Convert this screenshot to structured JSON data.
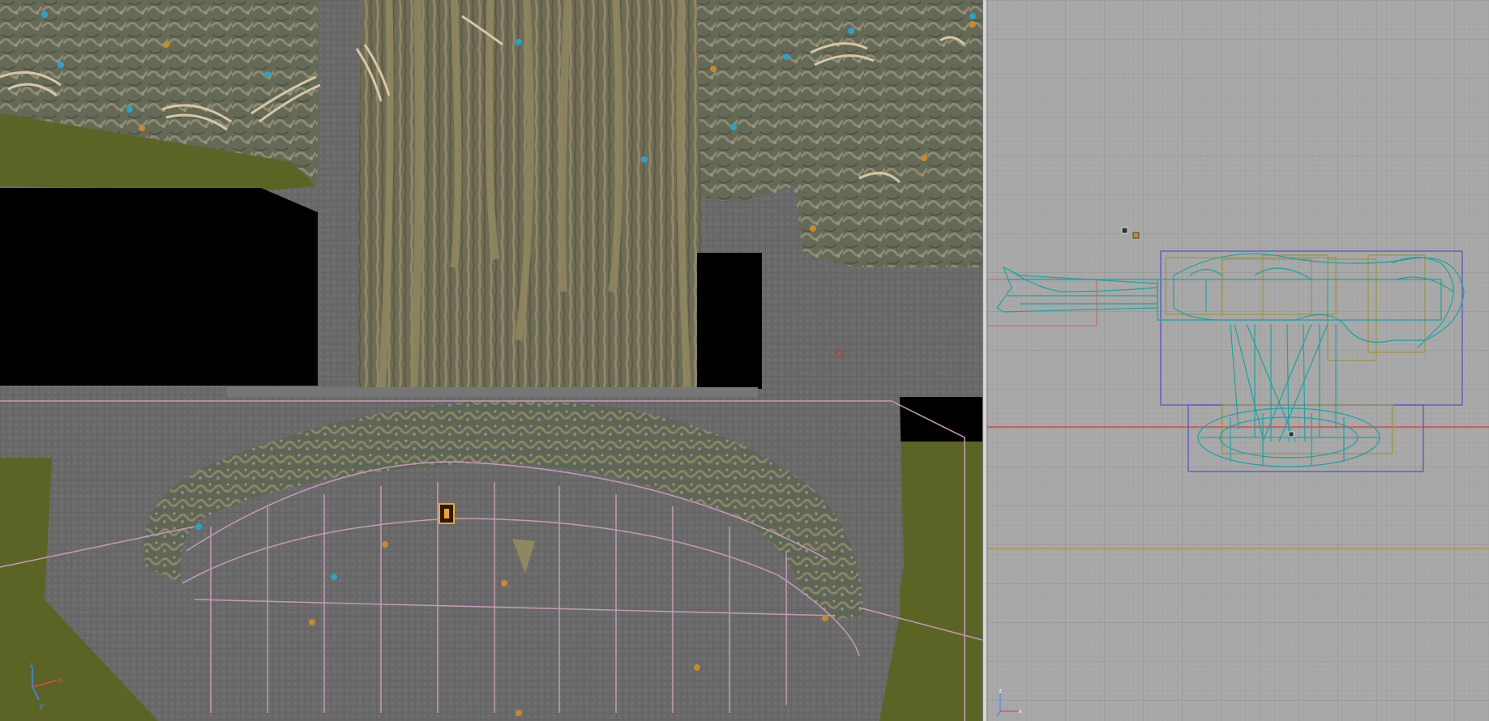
{
  "app": {
    "viewports": [
      {
        "id": "perspective",
        "axes": {
          "x": "x",
          "y": "y",
          "z": "z"
        }
      },
      {
        "id": "top",
        "axes": {
          "x": "x",
          "y": "y",
          "z": "z"
        }
      }
    ]
  },
  "colors": {
    "void": "#000000",
    "ground": "#5b6425",
    "stone": "#6d6d6d",
    "cave_rock": "#6d705f",
    "bark": "#7e7658",
    "brush_outline": "#c79ab9",
    "mesh_wire": "#1aa3a3",
    "bounding_box": "#4f4fc9",
    "brush_wire": "#9b8f2b",
    "axis_line": "#e23b3b",
    "grid_bg": "#a9a9a9",
    "grid_line": "#9a9a9a",
    "gizmo_x": "#3d8cff",
    "gizmo_y": "#e04d4d",
    "gizmo_z": "#3d8cff"
  },
  "icons": [
    "light-icon",
    "sound-icon",
    "player-start-icon",
    "origin-gizmo-icon"
  ]
}
